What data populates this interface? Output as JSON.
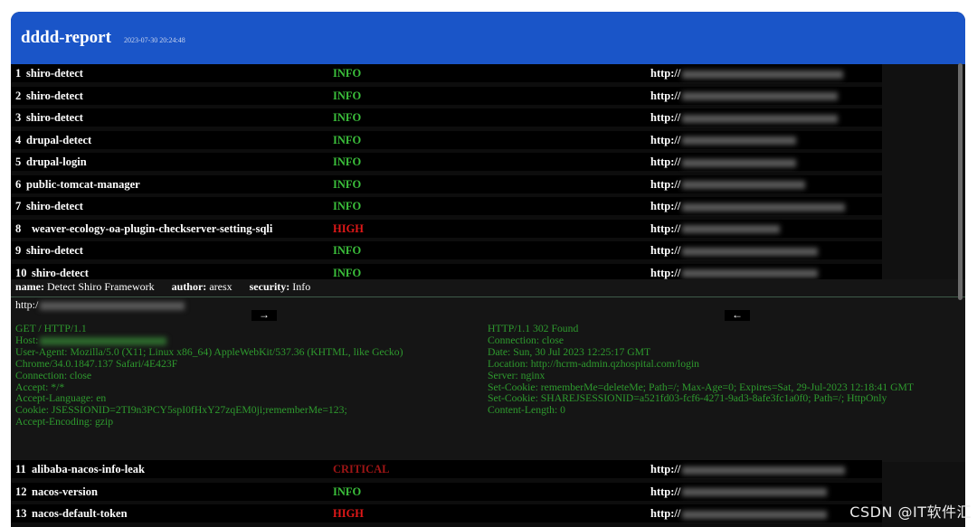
{
  "header": {
    "title": "dddd-report",
    "timestamp": "2023-07-30 20:24:48"
  },
  "rows": [
    {
      "index": "1",
      "name": "shiro-detect",
      "severity": "INFO",
      "url": "http://"
    },
    {
      "index": "2",
      "name": "shiro-detect",
      "severity": "INFO",
      "url": "http://"
    },
    {
      "index": "3",
      "name": "shiro-detect",
      "severity": "INFO",
      "url": "http://"
    },
    {
      "index": "4",
      "name": "drupal-detect",
      "severity": "INFO",
      "url": "http://"
    },
    {
      "index": "5",
      "name": "drupal-login",
      "severity": "INFO",
      "url": "http://"
    },
    {
      "index": "6",
      "name": "public-tomcat-manager",
      "severity": "INFO",
      "url": "http://"
    },
    {
      "index": "7",
      "name": "shiro-detect",
      "severity": "INFO",
      "url": "http://"
    },
    {
      "index": "8",
      "name": "weaver-ecology-oa-plugin-checkserver-setting-sqli",
      "severity": "HIGH",
      "url": "http://"
    },
    {
      "index": "9",
      "name": "shiro-detect",
      "severity": "INFO",
      "url": "http://"
    },
    {
      "index": "10",
      "name": "shiro-detect",
      "severity": "INFO",
      "url": "http://"
    }
  ],
  "rows_after": [
    {
      "index": "11",
      "name": "alibaba-nacos-info-leak",
      "severity": "CRITICAL",
      "url": "http://"
    },
    {
      "index": "12",
      "name": "nacos-version",
      "severity": "INFO",
      "url": "http://"
    },
    {
      "index": "13",
      "name": "nacos-default-token",
      "severity": "HIGH",
      "url": "http://"
    }
  ],
  "detail": {
    "name_label": "name:",
    "name_value": "Detect Shiro Framework",
    "author_label": "author:",
    "author_value": "aresx",
    "security_label": "security:",
    "security_value": "Info",
    "url": "http:/",
    "arrow_request": "→",
    "arrow_response": "←",
    "request_lines": [
      "GET / HTTP/1.1",
      "Host:",
      "User-Agent: Mozilla/5.0 (X11; Linux x86_64) AppleWebKit/537.36 (KHTML, like Gecko)",
      "Chrome/34.0.1847.137 Safari/4E423F",
      "Connection: close",
      "Accept: */*",
      "Accept-Language: en",
      "Cookie: JSESSIONID=2TI9n3PCY5spI0fHxY27zqEM0ji;rememberMe=123;",
      "Accept-Encoding: gzip"
    ],
    "response_lines": [
      "HTTP/1.1 302 Found",
      "Connection: close",
      "Date: Sun, 30 Jul 2023 12:25:17 GMT",
      "Location: http://hcrm-admin.qzhospital.com/login",
      "Server: nginx",
      "Set-Cookie: rememberMe=deleteMe; Path=/; Max-Age=0; Expires=Sat, 29-Jul-2023 12:18:41 GMT",
      "Set-Cookie: SHAREJSESSIONID=a521fd03-fcf6-4271-9ad3-8afe3fc1a0f0; Path=/; HttpOnly",
      "Content-Length: 0"
    ]
  },
  "watermark": "CSDN @IT软件汇",
  "colors": {
    "header": "#1a55c8",
    "info": "#3bbf3b",
    "high": "#e01818",
    "critical": "#9e1515",
    "http_text": "#2e9a2e"
  }
}
